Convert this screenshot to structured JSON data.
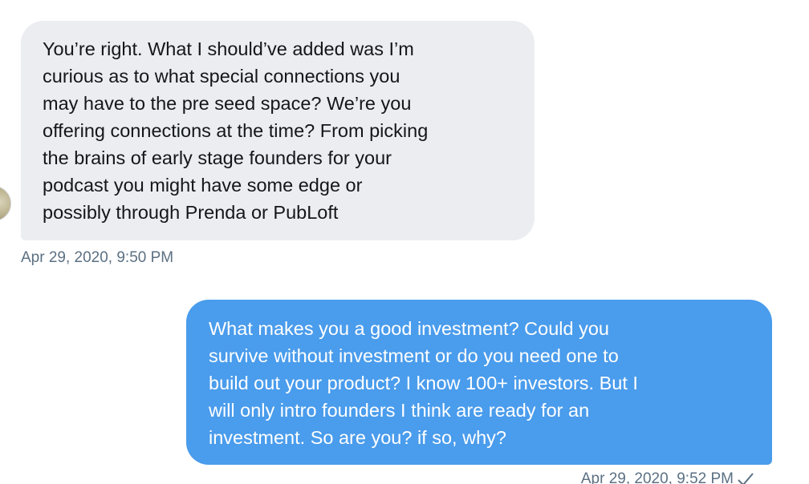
{
  "messages": [
    {
      "direction": "received",
      "text": "You’re right. What I should’ve added was I’m\ncurious as to what special connections you\nmay have to the pre seed space? We’re you\noffering connections at the time? From picking\nthe brains of early stage founders for your\npodcast you might have some edge or\npossibly through Prenda or PubLoft",
      "timestamp": "Apr 29, 2020, 9:50 PM"
    },
    {
      "direction": "sent",
      "text": "What makes you a good investment? Could you\nsurvive without investment or do you need one to\nbuild out your product? I know 100+ investors. But I\nwill only intro founders I think are ready for an\ninvestment. So are you? if so, why?",
      "timestamp": "Apr 29, 2020, 9:52 PM"
    }
  ],
  "colors": {
    "received_bubble": "#ebedf0",
    "sent_bubble": "#4a9cec",
    "timestamp": "#5b7083"
  },
  "icons": {
    "read_receipt": "checkmark-icon",
    "avatar": "user-avatar"
  }
}
